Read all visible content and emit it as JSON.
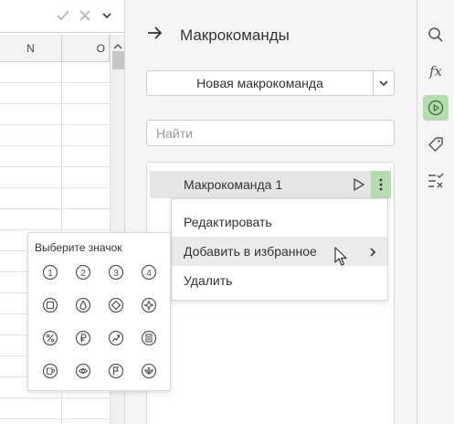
{
  "sheet": {
    "columns": [
      "N",
      "O"
    ],
    "formula_bar": {
      "accept_icon": "check-icon",
      "cancel_icon": "close-icon",
      "expand_icon": "chevron-down-icon"
    }
  },
  "panel": {
    "title": "Макрокоманды",
    "back_icon": "arrow-right-icon",
    "new_macro_label": "Новая макрокоманда",
    "search_placeholder": "Найти",
    "macros": [
      {
        "label": "Макрокоманда 1"
      }
    ]
  },
  "context_menu": {
    "items": [
      {
        "label": "Редактировать"
      },
      {
        "label": "Добавить в избранное",
        "has_submenu": true
      },
      {
        "label": "Удалить"
      }
    ]
  },
  "icon_picker": {
    "title": "Выберите значок",
    "icons": [
      "circle-1-icon",
      "circle-2-icon",
      "circle-3-icon",
      "circle-4-icon",
      "square-icon",
      "drop-icon",
      "diamond-icon",
      "sparkle-icon",
      "percent-icon",
      "ruble-icon",
      "trend-arrow-icon",
      "document-icon",
      "cup-icon",
      "eye-icon",
      "flag-icon",
      "lotus-icon"
    ],
    "digits": [
      "1",
      "2",
      "3",
      "4"
    ]
  },
  "toolbar": {
    "items": [
      "search-icon",
      "fx-icon",
      "macros-icon",
      "tag-icon",
      "checklist-icon"
    ],
    "fx_label": "fx",
    "active": "macros-icon"
  },
  "colors": {
    "accent": "#b7dbb1",
    "panel_bg": "#f5f5f5"
  }
}
